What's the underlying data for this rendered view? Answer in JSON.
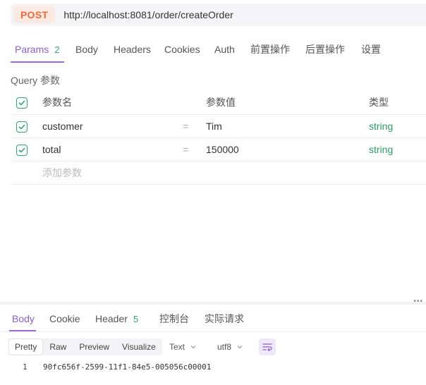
{
  "request": {
    "method": "POST",
    "url": "http://localhost:8081/order/createOrder"
  },
  "request_tabs": [
    {
      "label": "Params",
      "count": "2"
    },
    {
      "label": "Body"
    },
    {
      "label": "Headers"
    },
    {
      "label": "Cookies"
    },
    {
      "label": "Auth"
    },
    {
      "label": "前置操作"
    },
    {
      "label": "后置操作"
    },
    {
      "label": "设置"
    }
  ],
  "active_request_tab": "Params",
  "query_section_title": "Query 参数",
  "params_table": {
    "headers": {
      "name": "参数名",
      "value": "参数值",
      "type": "类型"
    },
    "rows": [
      {
        "enabled": true,
        "name": "customer",
        "eq": "=",
        "value": "Tim",
        "type": "string"
      },
      {
        "enabled": true,
        "name": "total",
        "eq": "=",
        "value": "150000",
        "type": "string"
      }
    ],
    "add_placeholder": "添加参数"
  },
  "response_tabs": [
    {
      "label": "Body"
    },
    {
      "label": "Cookie"
    },
    {
      "label": "Header",
      "count": "5"
    },
    {
      "label": "控制台"
    },
    {
      "label": "实际请求"
    }
  ],
  "active_response_tab": "Body",
  "response_toolbar": {
    "view_modes": [
      "Pretty",
      "Raw",
      "Preview",
      "Visualize"
    ],
    "active_view_mode": "Pretty",
    "format": "Text",
    "encoding": "utf8"
  },
  "response_body": [
    {
      "line": "1",
      "text": "90fc656f-2599-11f1-84e5-005056c00001"
    }
  ],
  "colors": {
    "accent": "#8b5fc4",
    "post_method": "#ef6a3a",
    "type_green": "#2e9a63"
  }
}
